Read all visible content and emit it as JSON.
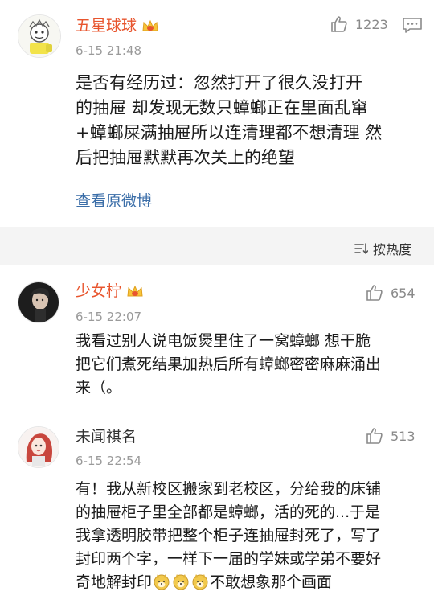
{
  "post": {
    "username": "五星球球",
    "time": "6-15 21:48",
    "likes": "1223",
    "text_lines": [
      "是否有经历过：忽然打开了很久没打开",
      "的抽屉 却发现无数只蟑螂正在里面乱窜",
      "+蟑螂屎满抽屉所以连清理都不想清理 然",
      "后把抽屉默默再次关上的绝望"
    ],
    "view_original": "查看原微博"
  },
  "sort": {
    "label": "按热度"
  },
  "comments": [
    {
      "username": "少女柠",
      "time": "6-15 22:07",
      "likes": "654",
      "text_lines": [
        "我看过别人说电饭煲里住了一窝蟑螂 想干脆",
        "把它们煮死结果加热后所有蟑螂密密麻麻涌出",
        "来（。"
      ]
    },
    {
      "username": "未闻祺名",
      "time": "6-15 22:54",
      "likes": "513",
      "text_lines": [
        "有！我从新校区搬家到老校区，分给我的床铺",
        "的抽屉柜子里全部都是蟑螂，活的死的...于是",
        "我拿透明胶带把整个柜子连抽屉封死了，写了",
        "封印两个字，一样下一届的学妹或学弟不要好"
      ],
      "last_line_pre": "奇地解封印",
      "last_line_post": "不敢想象那个画面"
    }
  ],
  "colors": {
    "vip_name": "#e8552e",
    "link": "#3b6ea8",
    "meta_gray": "#9a9a9a",
    "band": "#f4f4f4"
  },
  "icons": {
    "like": "thumbs-up-icon",
    "more": "chat-bubble-more-icon",
    "sort": "sort-icon",
    "vip": "crown-icon",
    "emoji": "doge-emoji-icon"
  }
}
